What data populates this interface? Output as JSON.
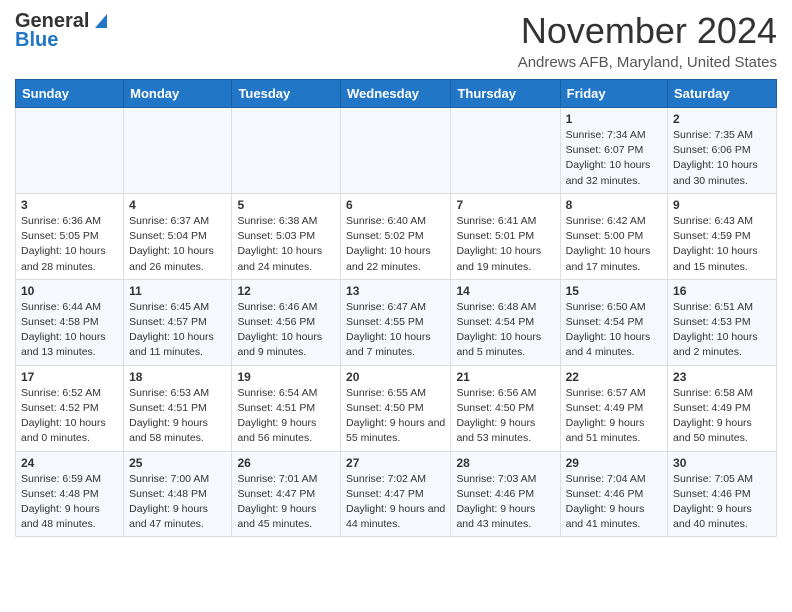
{
  "header": {
    "logo_general": "General",
    "logo_blue": "Blue",
    "month": "November 2024",
    "location": "Andrews AFB, Maryland, United States"
  },
  "weekdays": [
    "Sunday",
    "Monday",
    "Tuesday",
    "Wednesday",
    "Thursday",
    "Friday",
    "Saturday"
  ],
  "weeks": [
    [
      {
        "day": "",
        "info": ""
      },
      {
        "day": "",
        "info": ""
      },
      {
        "day": "",
        "info": ""
      },
      {
        "day": "",
        "info": ""
      },
      {
        "day": "",
        "info": ""
      },
      {
        "day": "1",
        "info": "Sunrise: 7:34 AM\nSunset: 6:07 PM\nDaylight: 10 hours and 32 minutes."
      },
      {
        "day": "2",
        "info": "Sunrise: 7:35 AM\nSunset: 6:06 PM\nDaylight: 10 hours and 30 minutes."
      }
    ],
    [
      {
        "day": "3",
        "info": "Sunrise: 6:36 AM\nSunset: 5:05 PM\nDaylight: 10 hours and 28 minutes."
      },
      {
        "day": "4",
        "info": "Sunrise: 6:37 AM\nSunset: 5:04 PM\nDaylight: 10 hours and 26 minutes."
      },
      {
        "day": "5",
        "info": "Sunrise: 6:38 AM\nSunset: 5:03 PM\nDaylight: 10 hours and 24 minutes."
      },
      {
        "day": "6",
        "info": "Sunrise: 6:40 AM\nSunset: 5:02 PM\nDaylight: 10 hours and 22 minutes."
      },
      {
        "day": "7",
        "info": "Sunrise: 6:41 AM\nSunset: 5:01 PM\nDaylight: 10 hours and 19 minutes."
      },
      {
        "day": "8",
        "info": "Sunrise: 6:42 AM\nSunset: 5:00 PM\nDaylight: 10 hours and 17 minutes."
      },
      {
        "day": "9",
        "info": "Sunrise: 6:43 AM\nSunset: 4:59 PM\nDaylight: 10 hours and 15 minutes."
      }
    ],
    [
      {
        "day": "10",
        "info": "Sunrise: 6:44 AM\nSunset: 4:58 PM\nDaylight: 10 hours and 13 minutes."
      },
      {
        "day": "11",
        "info": "Sunrise: 6:45 AM\nSunset: 4:57 PM\nDaylight: 10 hours and 11 minutes."
      },
      {
        "day": "12",
        "info": "Sunrise: 6:46 AM\nSunset: 4:56 PM\nDaylight: 10 hours and 9 minutes."
      },
      {
        "day": "13",
        "info": "Sunrise: 6:47 AM\nSunset: 4:55 PM\nDaylight: 10 hours and 7 minutes."
      },
      {
        "day": "14",
        "info": "Sunrise: 6:48 AM\nSunset: 4:54 PM\nDaylight: 10 hours and 5 minutes."
      },
      {
        "day": "15",
        "info": "Sunrise: 6:50 AM\nSunset: 4:54 PM\nDaylight: 10 hours and 4 minutes."
      },
      {
        "day": "16",
        "info": "Sunrise: 6:51 AM\nSunset: 4:53 PM\nDaylight: 10 hours and 2 minutes."
      }
    ],
    [
      {
        "day": "17",
        "info": "Sunrise: 6:52 AM\nSunset: 4:52 PM\nDaylight: 10 hours and 0 minutes."
      },
      {
        "day": "18",
        "info": "Sunrise: 6:53 AM\nSunset: 4:51 PM\nDaylight: 9 hours and 58 minutes."
      },
      {
        "day": "19",
        "info": "Sunrise: 6:54 AM\nSunset: 4:51 PM\nDaylight: 9 hours and 56 minutes."
      },
      {
        "day": "20",
        "info": "Sunrise: 6:55 AM\nSunset: 4:50 PM\nDaylight: 9 hours and 55 minutes."
      },
      {
        "day": "21",
        "info": "Sunrise: 6:56 AM\nSunset: 4:50 PM\nDaylight: 9 hours and 53 minutes."
      },
      {
        "day": "22",
        "info": "Sunrise: 6:57 AM\nSunset: 4:49 PM\nDaylight: 9 hours and 51 minutes."
      },
      {
        "day": "23",
        "info": "Sunrise: 6:58 AM\nSunset: 4:49 PM\nDaylight: 9 hours and 50 minutes."
      }
    ],
    [
      {
        "day": "24",
        "info": "Sunrise: 6:59 AM\nSunset: 4:48 PM\nDaylight: 9 hours and 48 minutes."
      },
      {
        "day": "25",
        "info": "Sunrise: 7:00 AM\nSunset: 4:48 PM\nDaylight: 9 hours and 47 minutes."
      },
      {
        "day": "26",
        "info": "Sunrise: 7:01 AM\nSunset: 4:47 PM\nDaylight: 9 hours and 45 minutes."
      },
      {
        "day": "27",
        "info": "Sunrise: 7:02 AM\nSunset: 4:47 PM\nDaylight: 9 hours and 44 minutes."
      },
      {
        "day": "28",
        "info": "Sunrise: 7:03 AM\nSunset: 4:46 PM\nDaylight: 9 hours and 43 minutes."
      },
      {
        "day": "29",
        "info": "Sunrise: 7:04 AM\nSunset: 4:46 PM\nDaylight: 9 hours and 41 minutes."
      },
      {
        "day": "30",
        "info": "Sunrise: 7:05 AM\nSunset: 4:46 PM\nDaylight: 9 hours and 40 minutes."
      }
    ]
  ]
}
